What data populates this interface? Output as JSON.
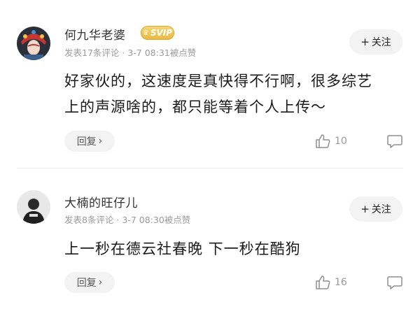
{
  "comments": [
    {
      "name": "何九华老婆",
      "badge": "SVIP",
      "meta": "发表17条评论 · 3-7 08:31被点赞",
      "follow": "关注",
      "text_lines": [
        "好家伙的，这速度是真快得不行啊，很多综艺",
        "上的声源啥的，都只能等着个人上传～"
      ],
      "reply": "回复",
      "likes": "10"
    },
    {
      "name": "大楠的旺仔儿",
      "meta": "发表8条评论 · 3-7 08:30被点赞",
      "follow": "关注",
      "text_lines": [
        "上一秒在德云社春晚 下一秒在酷狗"
      ],
      "reply": "回复",
      "likes": "16"
    }
  ],
  "icons": {
    "like": "thumbs-up-icon",
    "comment": "comment-bubble-icon",
    "chevron": "chevron-right-icon",
    "plus": "plus-icon",
    "crown": "crown-icon"
  },
  "colors": {
    "badge_gold": "#e8b93e",
    "button_bg": "#f3f3f3",
    "meta_gray": "#9a9a9a"
  }
}
